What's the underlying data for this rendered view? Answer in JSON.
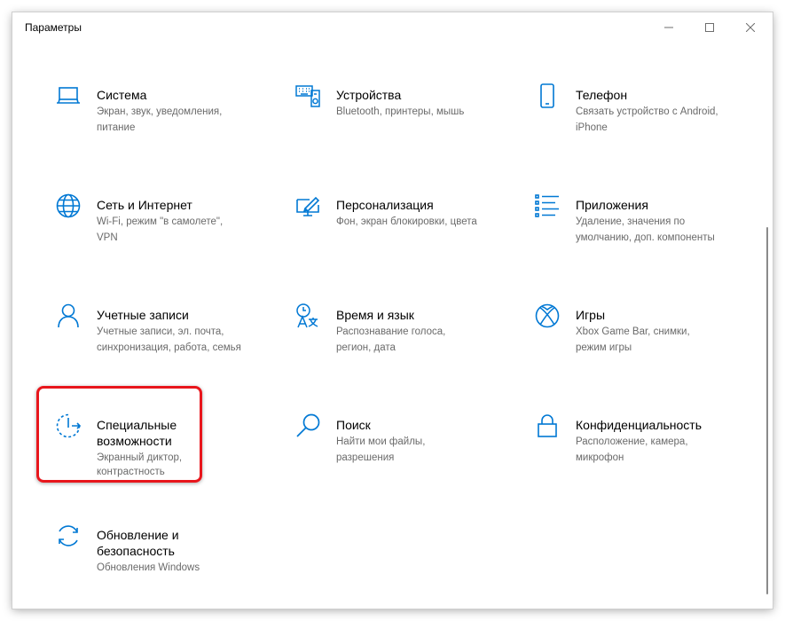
{
  "window": {
    "title": "Параметры"
  },
  "tiles": [
    {
      "name": "Система",
      "desc": [
        "Экран, звук, уведомления,",
        "питание"
      ],
      "icon": "laptop-icon"
    },
    {
      "name": "Устройства",
      "desc": [
        "Bluetooth, принтеры, мышь",
        ""
      ],
      "icon": "devices-icon"
    },
    {
      "name": "Телефон",
      "desc": [
        "Связать устройство с Android,",
        "iPhone"
      ],
      "icon": "phone-icon"
    },
    {
      "name": "Сеть и Интернет",
      "desc": [
        "Wi-Fi, режим \"в самолете\",",
        "VPN"
      ],
      "icon": "globe-icon"
    },
    {
      "name": "Персонализация",
      "desc": [
        "Фон, экран блокировки, цвета",
        ""
      ],
      "icon": "paint-icon"
    },
    {
      "name": "Приложения",
      "desc": [
        "Удаление, значения по",
        "умолчанию, доп. компоненты"
      ],
      "icon": "apps-list-icon"
    },
    {
      "name": "Учетные записи",
      "desc": [
        "Учетные записи, эл. почта,",
        "синхронизация, работа, семья"
      ],
      "icon": "person-icon"
    },
    {
      "name": "Время и язык",
      "desc": [
        "Распознавание голоса,",
        "регион, дата"
      ],
      "icon": "time-language-icon"
    },
    {
      "name": "Игры",
      "desc": [
        "Xbox Game Bar, снимки,",
        "режим игры"
      ],
      "icon": "xbox-icon"
    },
    {
      "name1": "Специальные",
      "name2": "возможности",
      "desc": [
        "Экранный диктор,",
        "контрастность"
      ],
      "icon": "accessibility-icon"
    },
    {
      "name": "Поиск",
      "desc": [
        "Найти мои файлы,",
        "разрешения"
      ],
      "icon": "search-icon"
    },
    {
      "name": "Конфиденциальность",
      "desc": [
        "Расположение, камера,",
        "микрофон"
      ],
      "icon": "lock-icon"
    },
    {
      "name1": "Обновление и",
      "name2": "безопасность",
      "desc": [
        "Обновления Windows",
        ""
      ],
      "icon": "update-icon"
    }
  ],
  "colors": {
    "accent": "#0078d4",
    "highlight": "#e8161c"
  }
}
